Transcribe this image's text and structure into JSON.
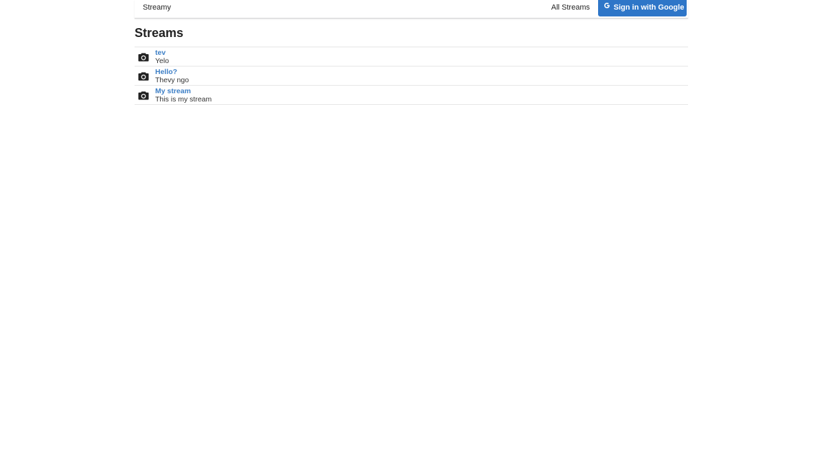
{
  "header": {
    "brand": "Streamy",
    "all_streams": "All Streams",
    "sign_in": "Sign in with Google",
    "sign_in_color": "#2e76c8"
  },
  "page": {
    "title": "Streams"
  },
  "streams": [
    {
      "title": "tev",
      "description": "Yelo",
      "icon": "camera-icon"
    },
    {
      "title": "Hello?",
      "description": "Thevy ngo",
      "icon": "camera-icon"
    },
    {
      "title": "My stream",
      "description": "This is my stream",
      "icon": "camera-icon"
    }
  ],
  "colors": {
    "link": "#3d7fc6",
    "divider": "#e6e6e6"
  }
}
